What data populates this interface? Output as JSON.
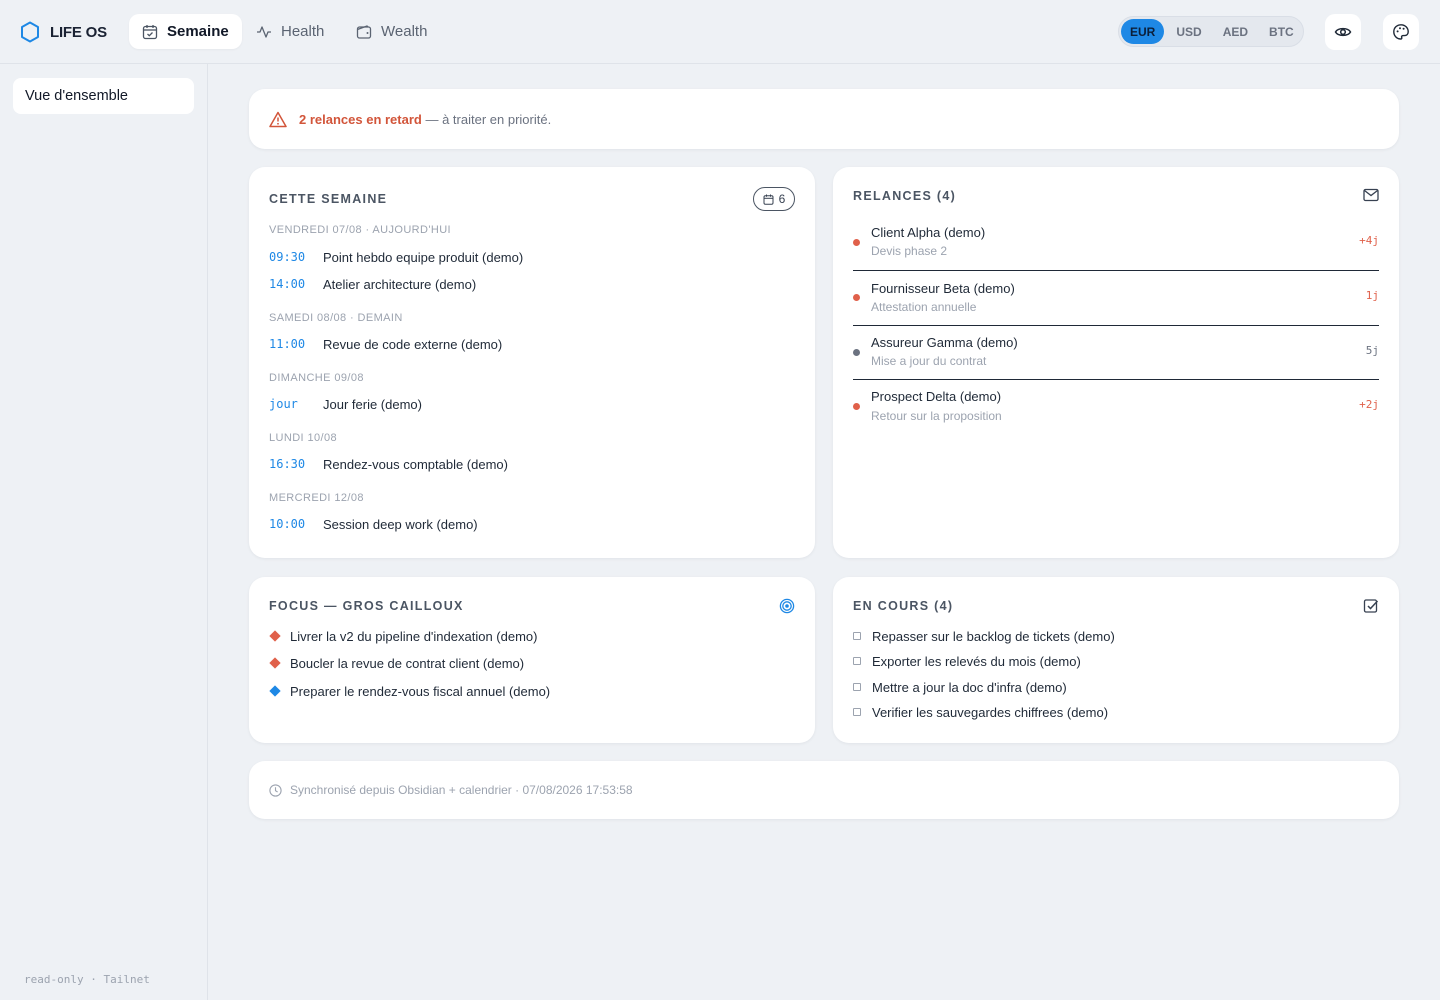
{
  "brand": {
    "name": "LIFE OS",
    "icon": "hexagon-icon",
    "accent": "#1e88e5"
  },
  "nav": {
    "tabs": [
      {
        "label": "Semaine",
        "icon": "calendar-check-icon",
        "active": true
      },
      {
        "label": "Health",
        "icon": "activity-icon",
        "active": false
      },
      {
        "label": "Wealth",
        "icon": "wallet-icon",
        "active": false
      }
    ]
  },
  "currency": {
    "options": [
      "EUR",
      "USD",
      "AED",
      "BTC"
    ],
    "selected": "EUR"
  },
  "toolbar": {
    "visibility_icon": "eye-icon",
    "theme_icon": "palette-icon"
  },
  "sidebar": {
    "items": [
      {
        "label": "Vue d'ensemble",
        "active": true
      }
    ],
    "footer": "read-only · Tailnet"
  },
  "alert": {
    "icon": "warning-triangle-icon",
    "strong": "2 relances en retard",
    "rest": " — à traiter en priorité.",
    "color": "#d2553a"
  },
  "week": {
    "title": "CETTE SEMAINE",
    "badge_icon": "calendar-icon",
    "badge_count": "6",
    "days": [
      {
        "label": "VENDREDI 07/08 · AUJOURD'HUI",
        "events": [
          {
            "time": "09:30",
            "title": "Point hebdo equipe produit (demo)"
          },
          {
            "time": "14:00",
            "title": "Atelier architecture (demo)"
          }
        ]
      },
      {
        "label": "SAMEDI 08/08 · DEMAIN",
        "events": [
          {
            "time": "11:00",
            "title": "Revue de code externe (demo)"
          }
        ]
      },
      {
        "label": "DIMANCHE 09/08",
        "events": [
          {
            "time": "jour",
            "title": "Jour ferie (demo)"
          }
        ]
      },
      {
        "label": "LUNDI 10/08",
        "events": [
          {
            "time": "16:30",
            "title": "Rendez-vous comptable (demo)"
          }
        ]
      },
      {
        "label": "MERCREDI 12/08",
        "events": [
          {
            "time": "10:00",
            "title": "Session deep work (demo)"
          }
        ]
      }
    ]
  },
  "relances": {
    "title": "RELANCES (4)",
    "icon": "mail-icon",
    "items": [
      {
        "name": "Client Alpha (demo)",
        "sub": "Devis phase 2",
        "delay": "+4j",
        "status": "overdue"
      },
      {
        "name": "Fournisseur Beta (demo)",
        "sub": "Attestation annuelle",
        "delay": "1j",
        "status": "overdue"
      },
      {
        "name": "Assureur Gamma (demo)",
        "sub": "Mise a jour du contrat",
        "delay": "5j",
        "status": "pending"
      },
      {
        "name": "Prospect Delta (demo)",
        "sub": "Retour sur la proposition",
        "delay": "+2j",
        "status": "overdue"
      }
    ],
    "colors": {
      "overdue": "#e0604a",
      "pending": "#6b7280"
    }
  },
  "focus": {
    "title": "FOCUS — GROS CAILLOUX",
    "icon": "target-icon",
    "items": [
      {
        "label": "Livrer la v2 du pipeline d'indexation (demo)",
        "color": "#e0604a"
      },
      {
        "label": "Boucler la revue de contrat client (demo)",
        "color": "#e0604a"
      },
      {
        "label": "Preparer le rendez-vous fiscal annuel (demo)",
        "color": "#1e88e5"
      }
    ]
  },
  "en_cours": {
    "title": "EN COURS (4)",
    "icon": "checkbox-icon",
    "items": [
      "Repasser sur le backlog de tickets (demo)",
      "Exporter les relevés du mois (demo)",
      "Mettre a jour la doc d'infra (demo)",
      "Verifier les sauvegardes chiffrees (demo)"
    ]
  },
  "sync": {
    "icon": "clock-icon",
    "text": "Synchronisé depuis Obsidian + calendrier · 07/08/2026 17:53:58"
  }
}
